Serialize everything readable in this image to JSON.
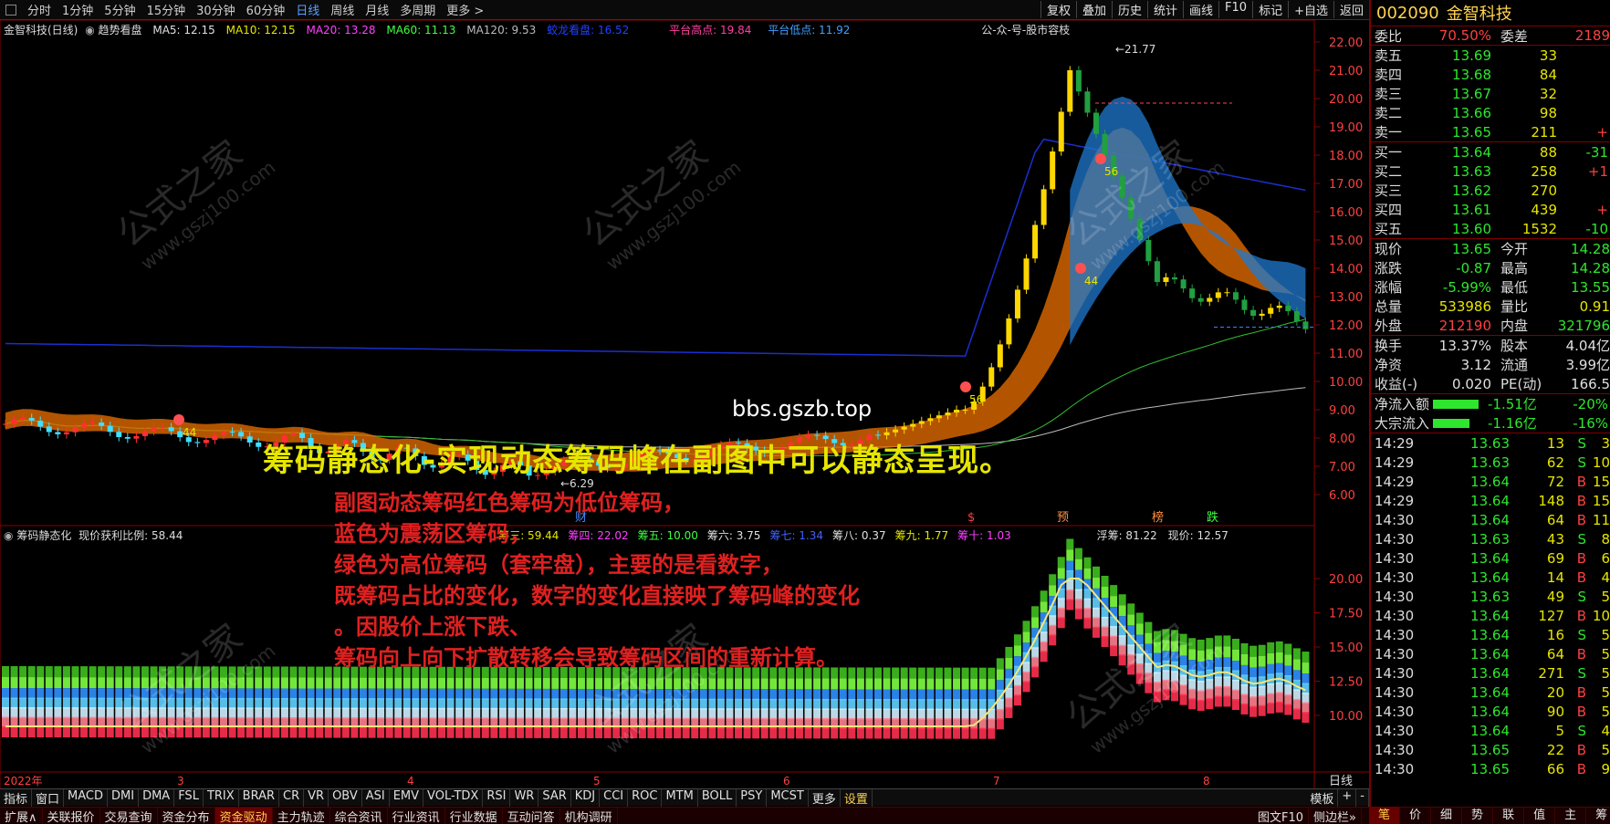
{
  "toolbar": {
    "periods": [
      "分时",
      "1分钟",
      "5分钟",
      "15分钟",
      "30分钟",
      "60分钟",
      "日线",
      "周线",
      "月线",
      "多周期",
      "更多 >"
    ],
    "active_period": "日线",
    "right_buttons": [
      "复权",
      "叠加",
      "历史",
      "统计",
      "画线",
      "F10",
      "标记",
      "+自选",
      "返回"
    ]
  },
  "main_indicator": {
    "title": "金智科技(日线)",
    "overlay_name": "趋势看盘",
    "ma5": "MA5: 12.15",
    "ma10": "MA10: 12.15",
    "ma20": "MA20: 13.28",
    "ma60": "MA60: 11.13",
    "ma120": "MA120: 9.53",
    "dragon": "蛟龙看盘: 16.52",
    "plat_high": "平台高点: 19.84",
    "plat_low": "平台低点: 11.92",
    "notice": "公-众-号-股市容枝",
    "peak_label": "21.77",
    "low_label": "6.29",
    "price_axis": [
      "22.00",
      "21.00",
      "20.00",
      "19.00",
      "18.00",
      "17.00",
      "16.00",
      "15.00",
      "14.00",
      "13.00",
      "12.00",
      "11.00",
      "10.00",
      "9.00",
      "8.00",
      "7.00",
      "6.00"
    ],
    "markers": [
      "44",
      "44",
      "56",
      "56"
    ],
    "bottom_tags": [
      "财",
      "$",
      "预",
      "榜",
      "跌"
    ]
  },
  "sub_indicator": {
    "title": "筹码静态化",
    "profit_ratio": "现价获利比例: 58.44",
    "items": [
      {
        "label": "筹三: 59.44",
        "color": "#e6e600"
      },
      {
        "label": "筹四: 22.02",
        "color": "#ff40ff"
      },
      {
        "label": "筹五: 10.00",
        "color": "#40ff40"
      },
      {
        "label": "筹六: 3.75",
        "color": "#e0e0e0"
      },
      {
        "label": "筹七: 1.34",
        "color": "#4060ff"
      },
      {
        "label": "筹八: 0.37",
        "color": "#e0e0e0"
      },
      {
        "label": "筹九: 1.77",
        "color": "#e6e600"
      },
      {
        "label": "筹十: 1.03",
        "color": "#ff40ff"
      }
    ],
    "float_chips": "浮筹: 81.22",
    "current_price": "现价: 12.57",
    "axis": [
      "20.00",
      "17.50",
      "15.00",
      "12.50",
      "10.00"
    ]
  },
  "date_axis": [
    "2022年",
    "3",
    "4",
    "5",
    "6",
    "7",
    "8"
  ],
  "period_label": "日线",
  "overlay": {
    "url": "bbs.gszb.top",
    "headline": "筹码静态化-实现动态筹码峰在副图中可以静态呈现。",
    "lines": [
      "副图动态筹码红色筹码为低位筹码，",
      "蓝色为震荡区筹码，",
      "绿色为高位筹码（套牢盘），主要的是看数字，",
      "既筹码占比的变化，数字的变化直接映了筹码峰的变化",
      "。因股价上涨下跌、",
      "筹码向上向下扩散转移会导致筹码区间的重新计算。"
    ],
    "watermark_cn": "公式之家",
    "watermark_url": "www.gszj100.com"
  },
  "indicator_tabs": [
    "指标",
    "窗口",
    "MACD",
    "DMI",
    "DMA",
    "FSL",
    "TRIX",
    "BRAR",
    "CR",
    "VR",
    "OBV",
    "ASI",
    "EMV",
    "VOL-TDX",
    "RSI",
    "WR",
    "SAR",
    "KDJ",
    "CCI",
    "ROC",
    "MTM",
    "BOLL",
    "PSY",
    "MCST",
    "更多",
    "设置"
  ],
  "indicator_right": [
    "模板",
    "+",
    "-"
  ],
  "bottom_tabs": [
    "扩展∧",
    "关联报价",
    "交易查询",
    "资金分布",
    "资金驱动",
    "主力轨迹",
    "综合资讯",
    "行业资讯",
    "行业数据",
    "互动问答",
    "机构调研"
  ],
  "bottom_active": "资金驱动",
  "bottom_right": [
    "图文F10",
    "侧边栏»"
  ],
  "panel_tabs": [
    "笔",
    "价",
    "细",
    "势",
    "联",
    "值",
    "主",
    "筹"
  ],
  "quote": {
    "code": "002090",
    "name": "金智科技",
    "weibi_label": "委比",
    "weibi": "70.50%",
    "weicha_label": "委差",
    "weicha": "2189",
    "asks": [
      {
        "label": "卖五",
        "price": "13.69",
        "vol": "33",
        "chg": ""
      },
      {
        "label": "卖四",
        "price": "13.68",
        "vol": "84",
        "chg": ""
      },
      {
        "label": "卖三",
        "price": "13.67",
        "vol": "32",
        "chg": ""
      },
      {
        "label": "卖二",
        "price": "13.66",
        "vol": "98",
        "chg": ""
      },
      {
        "label": "卖一",
        "price": "13.65",
        "vol": "211",
        "chg": "+"
      }
    ],
    "bids": [
      {
        "label": "买一",
        "price": "13.64",
        "vol": "88",
        "chg": "-31"
      },
      {
        "label": "买二",
        "price": "13.63",
        "vol": "258",
        "chg": "+1"
      },
      {
        "label": "买三",
        "price": "13.62",
        "vol": "270",
        "chg": ""
      },
      {
        "label": "买四",
        "price": "13.61",
        "vol": "439",
        "chg": "+"
      },
      {
        "label": "买五",
        "price": "13.60",
        "vol": "1532",
        "chg": "-10"
      }
    ],
    "stats": [
      {
        "l1": "现价",
        "v1": "13.65",
        "c1": "green",
        "l2": "今开",
        "v2": "14.28",
        "c2": "green"
      },
      {
        "l1": "涨跌",
        "v1": "-0.87",
        "c1": "green",
        "l2": "最高",
        "v2": "14.28",
        "c2": "green"
      },
      {
        "l1": "涨幅",
        "v1": "-5.99%",
        "c1": "green",
        "l2": "最低",
        "v2": "13.55",
        "c2": "green"
      },
      {
        "l1": "总量",
        "v1": "533986",
        "c1": "yellow",
        "l2": "量比",
        "v2": "0.91",
        "c2": "yellow"
      },
      {
        "l1": "外盘",
        "v1": "212190",
        "c1": "red",
        "l2": "内盘",
        "v2": "321796",
        "c2": "green"
      }
    ],
    "stats2": [
      {
        "l1": "换手",
        "v1": "13.37%",
        "c1": "white",
        "l2": "股本",
        "v2": "4.04亿",
        "c2": "white"
      },
      {
        "l1": "净资",
        "v1": "3.12",
        "c1": "white",
        "l2": "流通",
        "v2": "3.99亿",
        "c2": "white"
      },
      {
        "l1": "收益(-)",
        "v1": "0.020",
        "c1": "white",
        "l2": "PE(动)",
        "v2": "166.5",
        "c2": "white"
      }
    ],
    "flows": [
      {
        "label": "净流入额",
        "val": "-1.51亿",
        "pct": "-20%"
      },
      {
        "label": "大宗流入",
        "val": "-1.16亿",
        "pct": "-16%"
      }
    ],
    "ticks": [
      {
        "time": "14:29",
        "price": "13.63",
        "vol": "13",
        "bs": "S",
        "n": "3"
      },
      {
        "time": "14:29",
        "price": "13.63",
        "vol": "62",
        "bs": "S",
        "n": "10"
      },
      {
        "time": "14:29",
        "price": "13.64",
        "vol": "72",
        "bs": "B",
        "n": "15"
      },
      {
        "time": "14:29",
        "price": "13.64",
        "vol": "148",
        "bs": "B",
        "n": "15"
      },
      {
        "time": "14:30",
        "price": "13.64",
        "vol": "64",
        "bs": "B",
        "n": "11"
      },
      {
        "time": "14:30",
        "price": "13.63",
        "vol": "43",
        "bs": "S",
        "n": "8"
      },
      {
        "time": "14:30",
        "price": "13.64",
        "vol": "69",
        "bs": "B",
        "n": "6"
      },
      {
        "time": "14:30",
        "price": "13.64",
        "vol": "14",
        "bs": "B",
        "n": "4"
      },
      {
        "time": "14:30",
        "price": "13.63",
        "vol": "49",
        "bs": "S",
        "n": "5"
      },
      {
        "time": "14:30",
        "price": "13.64",
        "vol": "127",
        "bs": "B",
        "n": "10"
      },
      {
        "time": "14:30",
        "price": "13.64",
        "vol": "16",
        "bs": "S",
        "n": "5"
      },
      {
        "time": "14:30",
        "price": "13.64",
        "vol": "64",
        "bs": "B",
        "n": "5"
      },
      {
        "time": "14:30",
        "price": "13.64",
        "vol": "271",
        "bs": "S",
        "n": "5"
      },
      {
        "time": "14:30",
        "price": "13.64",
        "vol": "20",
        "bs": "B",
        "n": "5"
      },
      {
        "time": "14:30",
        "price": "13.64",
        "vol": "90",
        "bs": "B",
        "n": "5"
      },
      {
        "time": "14:30",
        "price": "13.64",
        "vol": "5",
        "bs": "S",
        "n": "4"
      },
      {
        "time": "14:30",
        "price": "13.65",
        "vol": "22",
        "bs": "B",
        "n": "5"
      },
      {
        "time": "14:30",
        "price": "13.65",
        "vol": "66",
        "bs": "B",
        "n": "9"
      }
    ]
  },
  "colors": {
    "up": "#ff4040",
    "down": "#2ee62e",
    "accent": "#ffd24d",
    "border": "#800000"
  }
}
